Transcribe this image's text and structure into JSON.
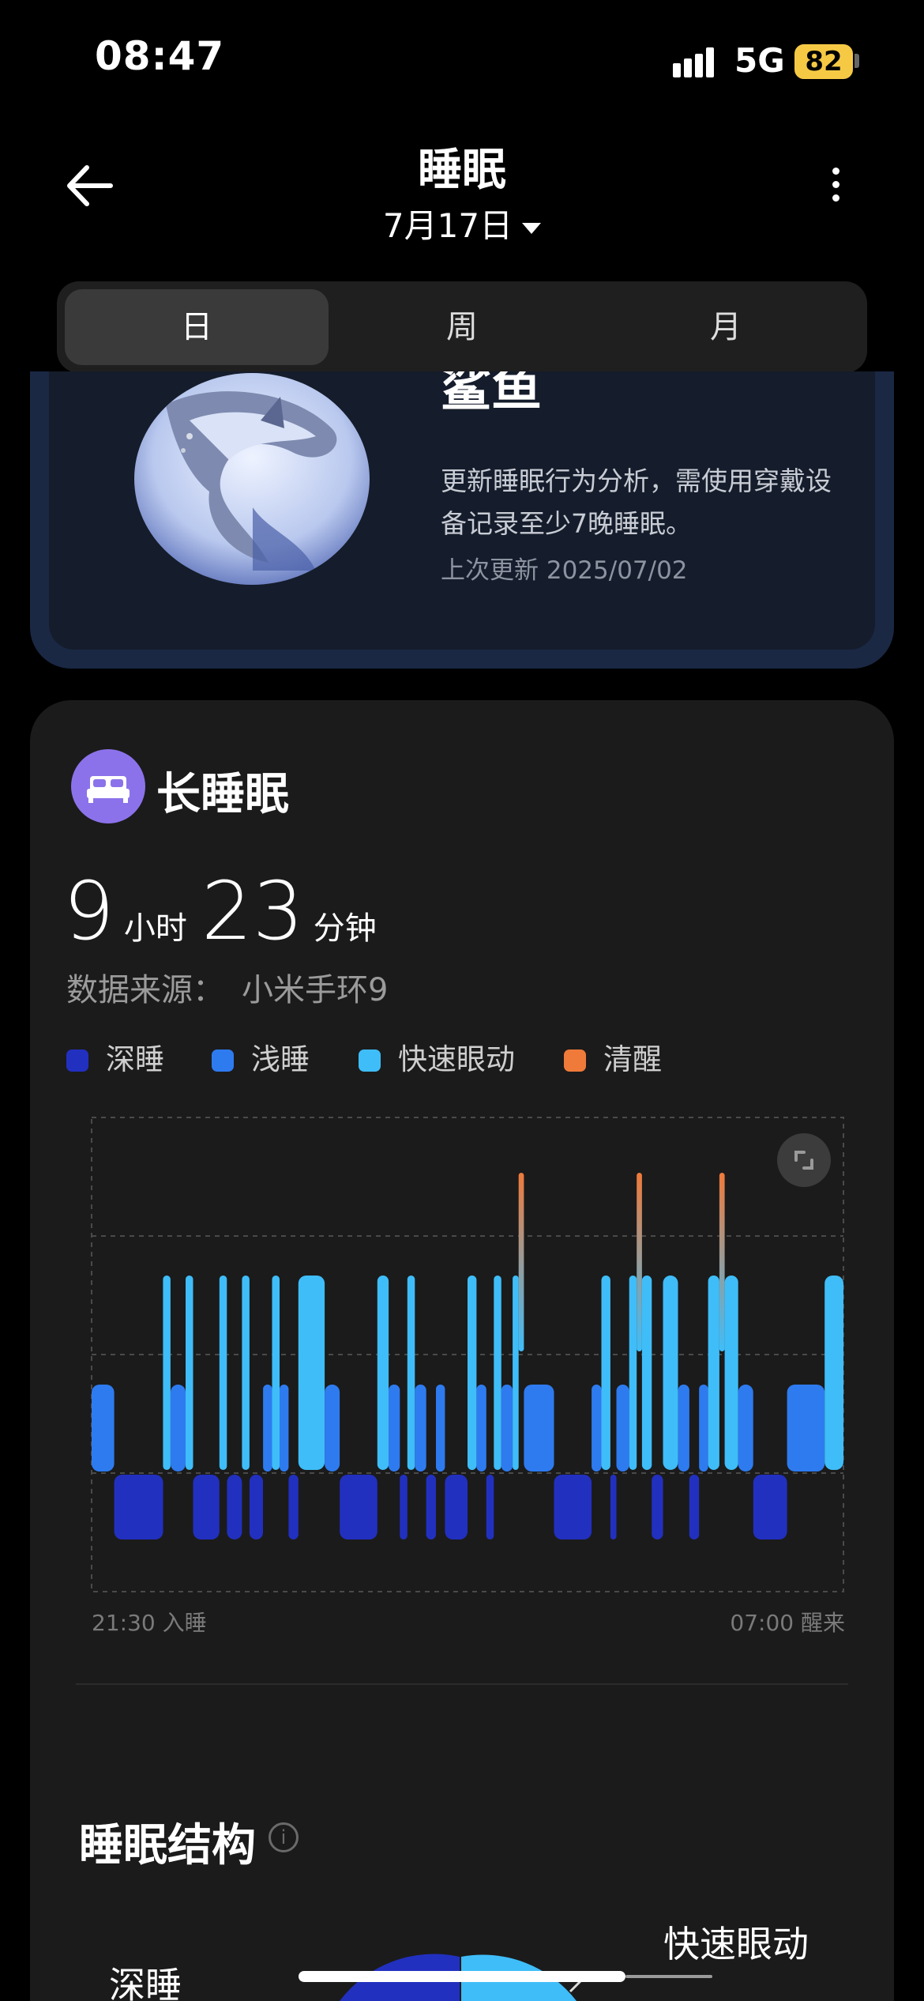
{
  "status_bar": {
    "time": "08:47",
    "network": "5G",
    "battery": "82"
  },
  "header": {
    "title": "睡眠",
    "date": "7月17日"
  },
  "tabs": [
    {
      "label": "日",
      "active": true
    },
    {
      "label": "周",
      "active": false
    },
    {
      "label": "月",
      "active": false
    }
  ],
  "animal_card": {
    "title": "鲨鱼",
    "description": "更新睡眠行为分析，需使用穿戴设备记录至少7晚睡眠。",
    "updated": "上次更新 2025/07/02"
  },
  "sleep_card": {
    "title": "长睡眠",
    "hours": "9",
    "hours_unit": "小时",
    "minutes": "23",
    "minutes_unit": "分钟",
    "source_label": "数据来源：",
    "source_value": "小米手环9"
  },
  "legend": [
    {
      "label": "深睡",
      "color": "#2230c0"
    },
    {
      "label": "浅睡",
      "color": "#2e7bf0"
    },
    {
      "label": "快速眼动",
      "color": "#3fbdf8"
    },
    {
      "label": "清醒",
      "color": "#f07a3a"
    }
  ],
  "chart_data": {
    "type": "area",
    "x_start_label": "21:30 入睡",
    "x_end_label": "07:00 醒来",
    "stage_levels": {
      "awake": 0,
      "rem": 1,
      "light": 2,
      "deep": 3
    },
    "segments": [
      {
        "stage": "light",
        "start": 0.0,
        "end": 0.03
      },
      {
        "stage": "deep",
        "start": 0.03,
        "end": 0.095
      },
      {
        "stage": "rem",
        "start": 0.095,
        "end": 0.105
      },
      {
        "stage": "light",
        "start": 0.105,
        "end": 0.125
      },
      {
        "stage": "rem",
        "start": 0.125,
        "end": 0.135
      },
      {
        "stage": "deep",
        "start": 0.135,
        "end": 0.17
      },
      {
        "stage": "rem",
        "start": 0.17,
        "end": 0.18
      },
      {
        "stage": "deep",
        "start": 0.18,
        "end": 0.2
      },
      {
        "stage": "rem",
        "start": 0.2,
        "end": 0.21
      },
      {
        "stage": "deep",
        "start": 0.21,
        "end": 0.228
      },
      {
        "stage": "light",
        "start": 0.228,
        "end": 0.24
      },
      {
        "stage": "rem",
        "start": 0.24,
        "end": 0.25
      },
      {
        "stage": "light",
        "start": 0.25,
        "end": 0.262
      },
      {
        "stage": "deep",
        "start": 0.262,
        "end": 0.275
      },
      {
        "stage": "rem",
        "start": 0.275,
        "end": 0.31
      },
      {
        "stage": "light",
        "start": 0.31,
        "end": 0.33
      },
      {
        "stage": "deep",
        "start": 0.33,
        "end": 0.38
      },
      {
        "stage": "rem",
        "start": 0.38,
        "end": 0.395
      },
      {
        "stage": "light",
        "start": 0.395,
        "end": 0.41
      },
      {
        "stage": "deep",
        "start": 0.41,
        "end": 0.42
      },
      {
        "stage": "rem",
        "start": 0.42,
        "end": 0.43
      },
      {
        "stage": "light",
        "start": 0.43,
        "end": 0.445
      },
      {
        "stage": "deep",
        "start": 0.445,
        "end": 0.458
      },
      {
        "stage": "light",
        "start": 0.458,
        "end": 0.47
      },
      {
        "stage": "deep",
        "start": 0.47,
        "end": 0.5
      },
      {
        "stage": "rem",
        "start": 0.5,
        "end": 0.512
      },
      {
        "stage": "light",
        "start": 0.512,
        "end": 0.525
      },
      {
        "stage": "deep",
        "start": 0.525,
        "end": 0.535
      },
      {
        "stage": "rem",
        "start": 0.535,
        "end": 0.545
      },
      {
        "stage": "light",
        "start": 0.545,
        "end": 0.56
      },
      {
        "stage": "rem",
        "start": 0.56,
        "end": 0.568
      },
      {
        "stage": "awake",
        "start": 0.568,
        "end": 0.575
      },
      {
        "stage": "light",
        "start": 0.575,
        "end": 0.615
      },
      {
        "stage": "deep",
        "start": 0.615,
        "end": 0.665
      },
      {
        "stage": "light",
        "start": 0.665,
        "end": 0.678
      },
      {
        "stage": "rem",
        "start": 0.678,
        "end": 0.69
      },
      {
        "stage": "deep",
        "start": 0.69,
        "end": 0.698
      },
      {
        "stage": "light",
        "start": 0.698,
        "end": 0.715
      },
      {
        "stage": "rem",
        "start": 0.715,
        "end": 0.725
      },
      {
        "stage": "awake",
        "start": 0.725,
        "end": 0.732
      },
      {
        "stage": "rem",
        "start": 0.732,
        "end": 0.745
      },
      {
        "stage": "deep",
        "start": 0.745,
        "end": 0.76
      },
      {
        "stage": "rem",
        "start": 0.76,
        "end": 0.78
      },
      {
        "stage": "light",
        "start": 0.78,
        "end": 0.795
      },
      {
        "stage": "deep",
        "start": 0.795,
        "end": 0.808
      },
      {
        "stage": "light",
        "start": 0.808,
        "end": 0.82
      },
      {
        "stage": "rem",
        "start": 0.82,
        "end": 0.835
      },
      {
        "stage": "awake",
        "start": 0.835,
        "end": 0.842
      },
      {
        "stage": "rem",
        "start": 0.842,
        "end": 0.86
      },
      {
        "stage": "light",
        "start": 0.86,
        "end": 0.88
      },
      {
        "stage": "deep",
        "start": 0.88,
        "end": 0.925
      },
      {
        "stage": "light",
        "start": 0.925,
        "end": 0.975
      },
      {
        "stage": "rem",
        "start": 0.975,
        "end": 1.0
      }
    ]
  },
  "structure": {
    "title": "睡眠结构",
    "rem_label": "快速眼动",
    "deep_label": "深睡"
  }
}
